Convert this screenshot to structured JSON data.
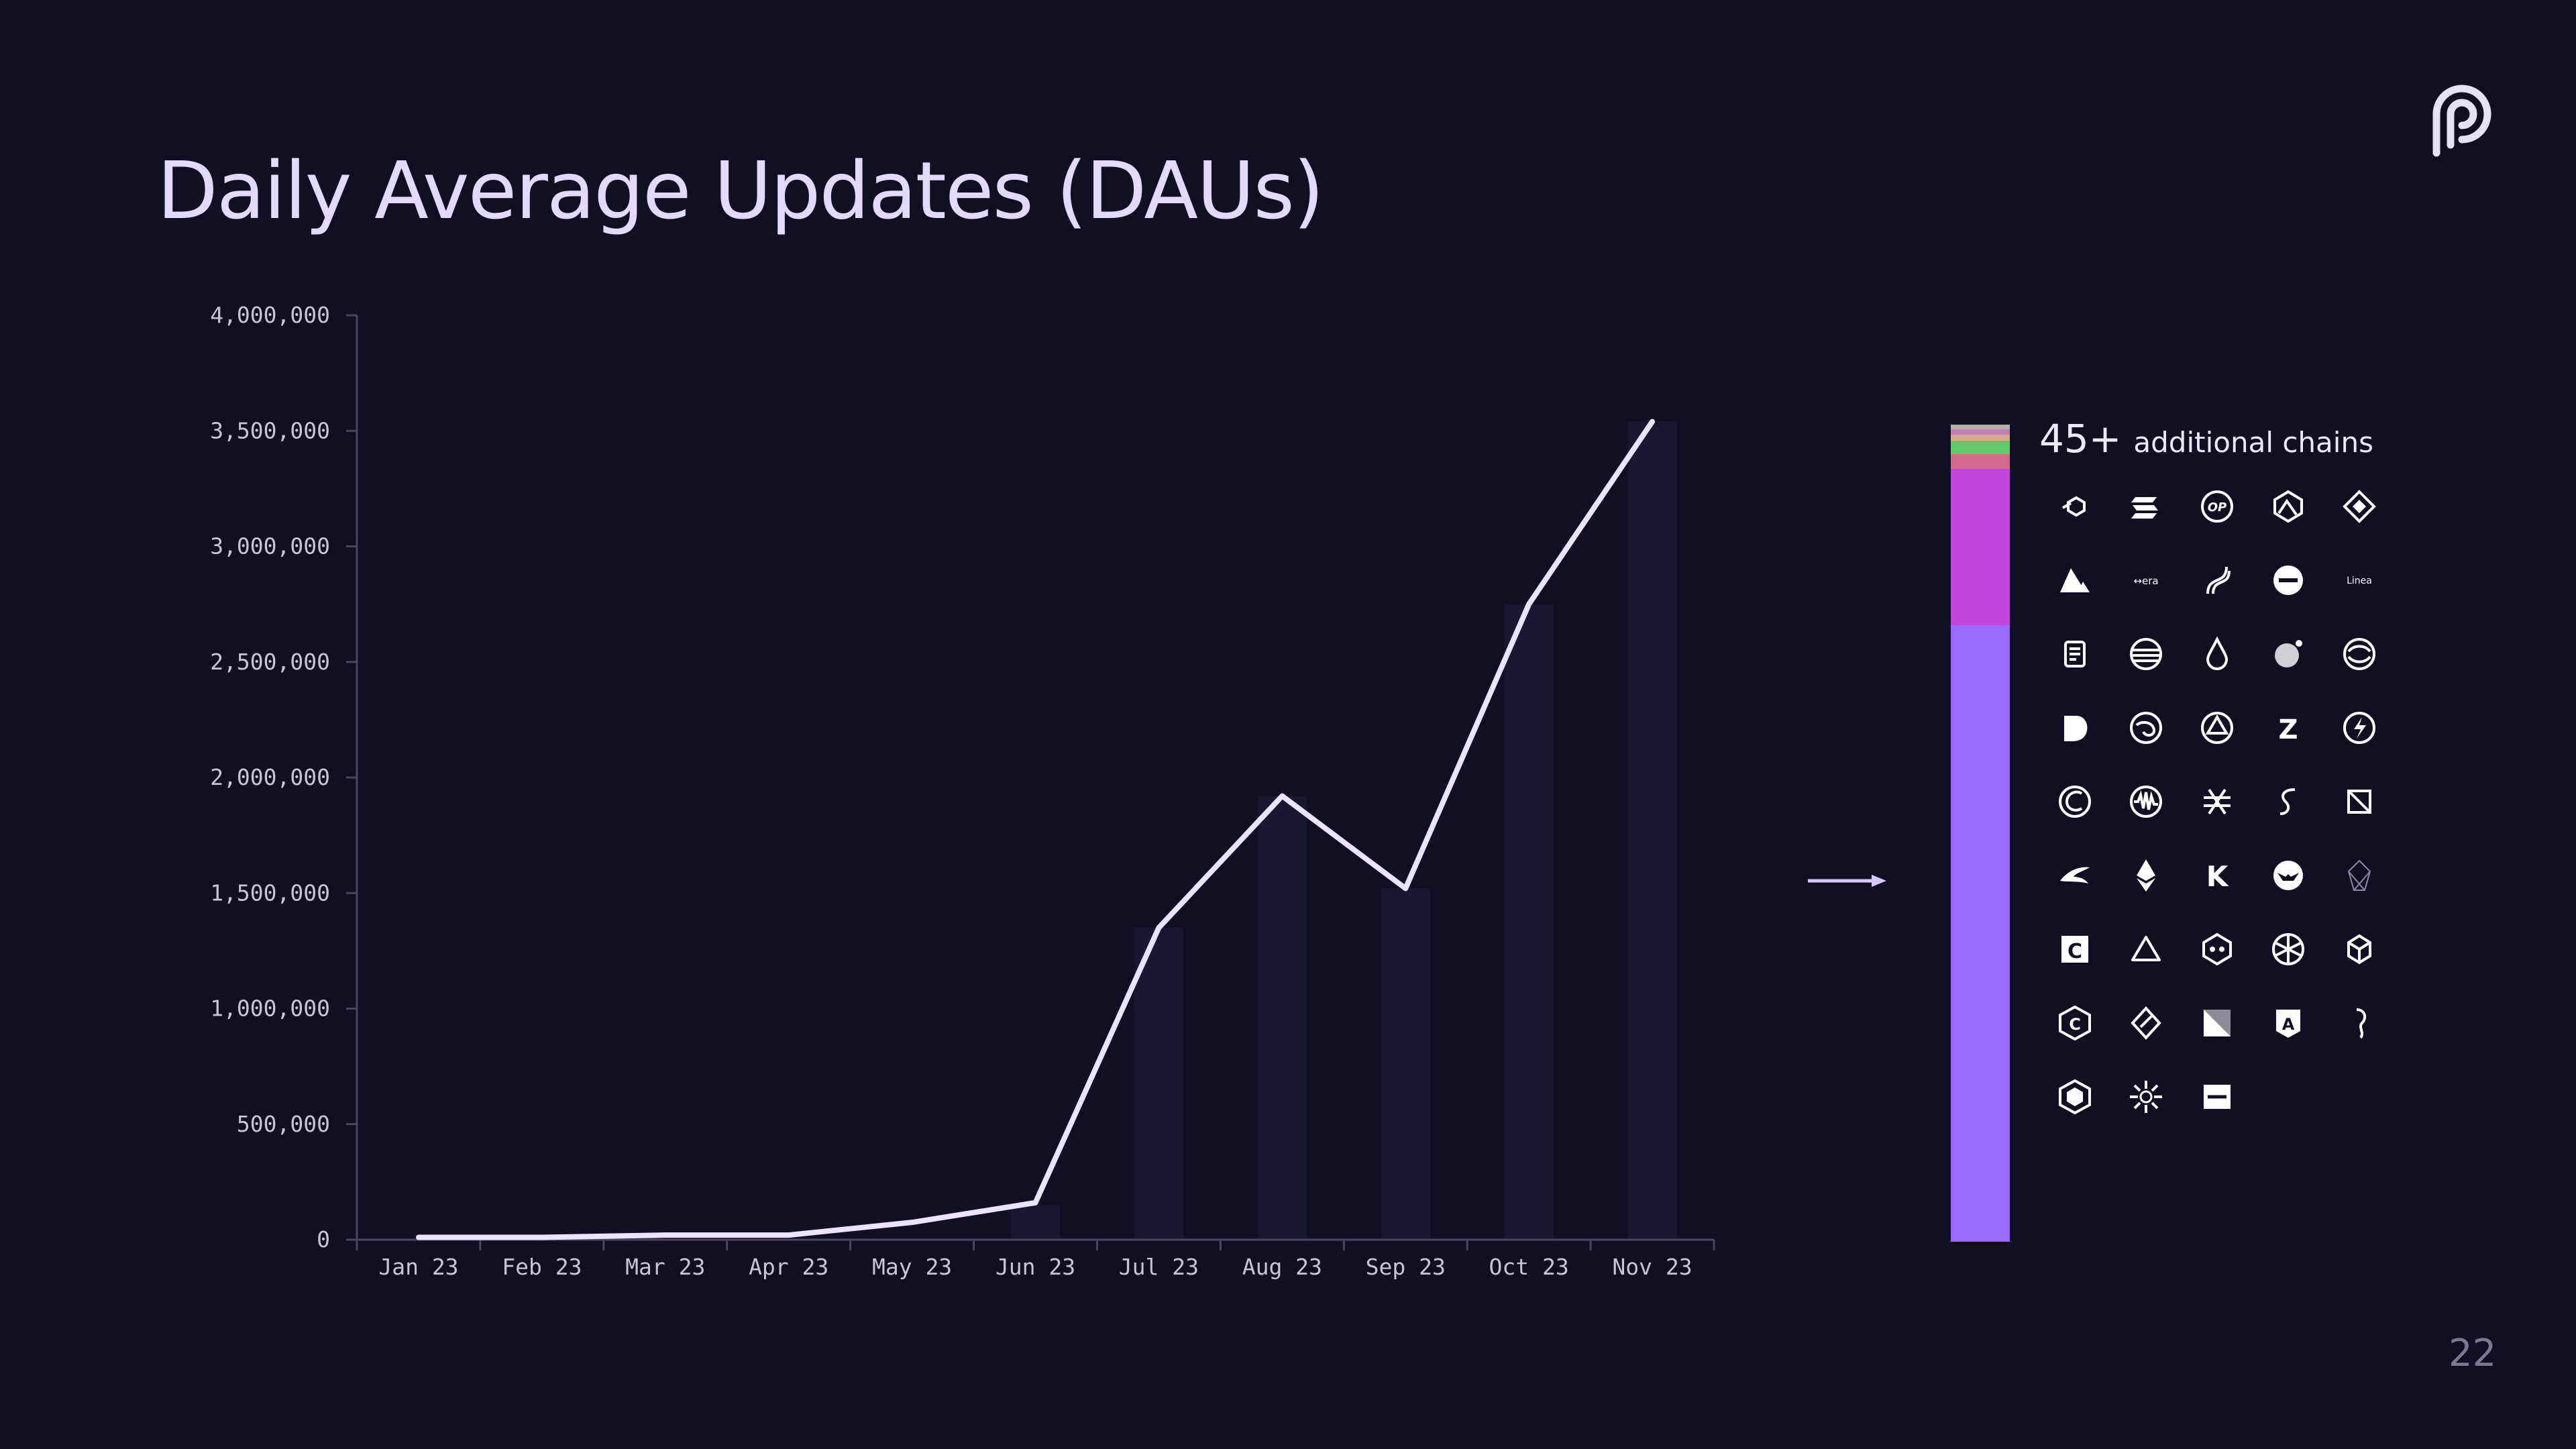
{
  "slide": {
    "title": "Daily Average Updates (DAUs)",
    "page_number": "22"
  },
  "chains": {
    "count_label": "45+",
    "text": "additional chains",
    "icons": [
      "chain-link-icon",
      "stacked-bars-icon",
      "op-icon",
      "mountain-shield-icon",
      "diamond-icon",
      "triangle-icon",
      "era-icon",
      "wave-icon",
      "minus-circle-icon",
      "linea-icon",
      "scroll-icon",
      "striped-circle-icon",
      "droplet-icon",
      "sphere-icon",
      "swirl-circle-icon",
      "blob-icon",
      "spiral-icon",
      "hex-nut-icon",
      "z-icon",
      "lightning-circle-icon",
      "ring-icon",
      "waveform-circle-icon",
      "asterisk-icon",
      "hook-icon",
      "cube-outline-icon",
      "bird-icon",
      "ethereum-icon",
      "k-icon",
      "mask-circle-icon",
      "eos-icon",
      "c-square-icon",
      "delta-outline-icon",
      "robot-icon",
      "snowflake-icon",
      "hexagon-cube-icon",
      "c-hexagon-icon",
      "rhombus-icon",
      "gradient-square-icon",
      "shield-a-icon",
      "seahorse-icon",
      "box-hexagon-icon",
      "sunburst-icon",
      "bracket-square-icon"
    ],
    "icon_labels": {
      "op": "OP",
      "era": "↔era",
      "linea": "Linea",
      "k": "K",
      "z": "Z",
      "c": "C"
    }
  },
  "breakdown": {
    "segments": [
      {
        "fraction": 0.75,
        "color": "#9b6bff"
      },
      {
        "fraction": 0.19,
        "color": "#c045d8"
      },
      {
        "fraction": 0.018,
        "color": "#d36a8f"
      },
      {
        "fraction": 0.016,
        "color": "#62c86c"
      },
      {
        "fraction": 0.008,
        "color": "#d9a98b"
      },
      {
        "fraction": 0.006,
        "color": "#c27dbd"
      },
      {
        "fraction": 0.006,
        "color": "#b3b0a8"
      }
    ]
  },
  "colors": {
    "background": "#100f24",
    "line": "#ece4ff",
    "axis": "#4a465f",
    "bar": "#1b1833"
  },
  "chart_data": {
    "type": "line",
    "categories": [
      "Jan 23",
      "Feb 23",
      "Mar 23",
      "Apr 23",
      "May 23",
      "Jun 23",
      "Jul 23",
      "Aug 23",
      "Sep 23",
      "Oct 23",
      "Nov 23"
    ],
    "series": [
      {
        "values": [
          10000,
          10000,
          20000,
          20000,
          75000,
          160000,
          1350000,
          1920000,
          1520000,
          2750000,
          3540000
        ]
      }
    ],
    "bars": [
      0,
      0,
      0,
      0,
      0,
      150000,
      1350000,
      1920000,
      1520000,
      2750000,
      3540000
    ],
    "yticks": [
      0,
      500000,
      1000000,
      1500000,
      2000000,
      2500000,
      3000000,
      3500000,
      4000000
    ],
    "ytick_labels": [
      "0",
      "500,000",
      "1,000,000",
      "1,500,000",
      "2,000,000",
      "2,500,000",
      "3,000,000",
      "3,500,000",
      "4,000,000"
    ],
    "ylim": [
      0,
      4000000
    ],
    "title": "",
    "xlabel": "",
    "ylabel": "",
    "grid": false
  }
}
